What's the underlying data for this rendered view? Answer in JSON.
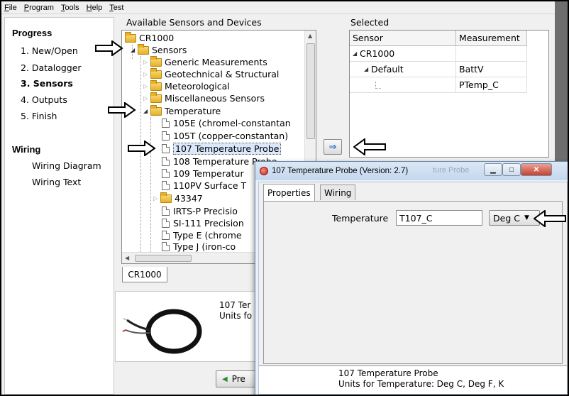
{
  "menu": [
    "File",
    "Program",
    "Tools",
    "Help",
    "Test"
  ],
  "progress": {
    "heading": "Progress",
    "steps": [
      "1. New/Open",
      "2. Datalogger",
      "3. Sensors",
      "4. Outputs",
      "5. Finish"
    ],
    "current_step_index": 2
  },
  "wiring": {
    "heading": "Wiring",
    "links": [
      "Wiring Diagram",
      "Wiring Text"
    ]
  },
  "available": {
    "label": "Available Sensors and Devices",
    "tree": [
      "CR1000",
      "Sensors",
      "Generic Measurements",
      "Geotechnical & Structural",
      "Meteorological",
      "Miscellaneous Sensors",
      "Temperature",
      "105E (chromel-constantan",
      "105T (copper-constantan)",
      "107 Temperature Probe",
      "108 Temperature Probe",
      "109 Temperatur",
      "110PV Surface T",
      "43347",
      "IRTS-P Precisio",
      "SI-111 Precision",
      "Type E (chrome",
      "Type J (iron-co"
    ],
    "tab_label": "CR1000"
  },
  "selected": {
    "label": "Selected",
    "headers": [
      "Sensor",
      "Measurement"
    ],
    "rows": [
      [
        "CR1000",
        ""
      ],
      [
        "Default",
        "BattV"
      ],
      [
        "",
        "PTemp_C"
      ]
    ]
  },
  "add_button_glyph": "⇒",
  "info": {
    "line1": "107 Ter",
    "line2": "Units fo"
  },
  "previous_button": "Pre",
  "dialog": {
    "title": "107 Temperature Probe (Version: 2.7)",
    "ghost_text": "ture Probe",
    "tabs": [
      "Properties",
      "Wiring"
    ],
    "field_label": "Temperature",
    "field_value": "T107_C",
    "unit_selected": "Deg C",
    "description_line1": "107 Temperature Probe",
    "description_line2": "Units for Temperature: Deg C, Deg F, K"
  }
}
